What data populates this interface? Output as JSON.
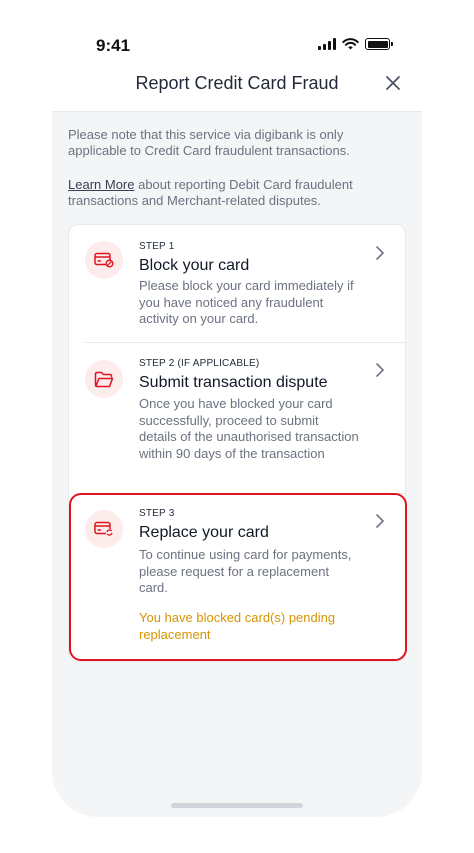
{
  "status_bar": {
    "time": "9:41"
  },
  "header": {
    "title": "Report Credit Card Fraud"
  },
  "notes": {
    "service_note": "Please note that this service via digibank is only applicable to Credit Card fraudulent transactions.",
    "learn_more_link": "Learn More",
    "learn_more_rest": " about reporting Debit Card fraudulent transactions and Merchant-related disputes."
  },
  "steps": [
    {
      "label": "STEP 1",
      "title": "Block your card",
      "description": "Please block your card immediately if you have noticed any fraudulent activity on your card.",
      "icon": "card-block-icon"
    },
    {
      "label": "STEP 2 (IF APPLICABLE)",
      "title": "Submit transaction dispute",
      "description": "Once you have blocked your card successfully, proceed to submit details of the unauthorised transaction within 90 days of the transaction",
      "icon": "folder-icon"
    },
    {
      "label": "STEP 3",
      "title": "Replace your card",
      "description": "To continue using card for payments, please request for a replacement card.",
      "warning": "You have blocked card(s) pending replacement",
      "icon": "card-replace-icon"
    }
  ],
  "colors": {
    "accent_red": "#e0141e",
    "icon_bg": "#fdecec",
    "warning": "#d69500"
  }
}
